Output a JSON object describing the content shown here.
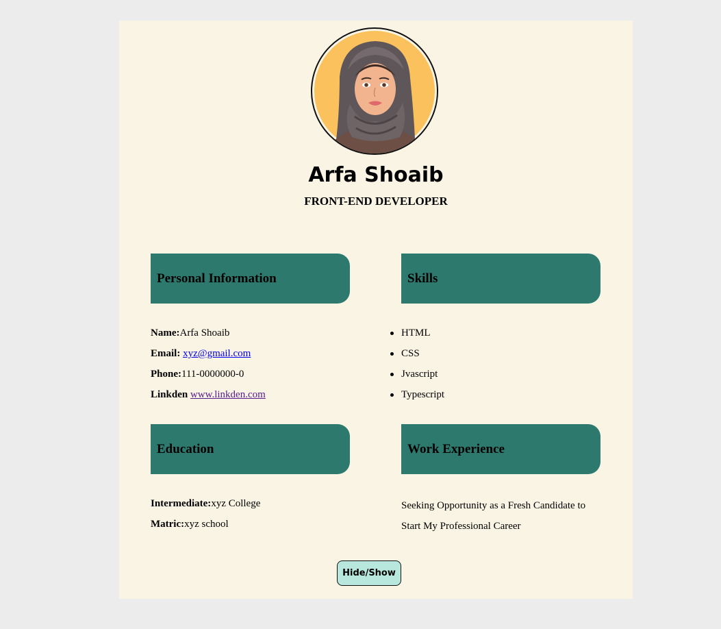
{
  "profile": {
    "name": "Arfa Shoaib",
    "role": "FRONT-END DEVELOPER",
    "avatar_icon": "hijab-woman-avatar"
  },
  "colors": {
    "page_background": "#ececec",
    "card_background": "#faf4e5",
    "section_header": "#2d796e",
    "button_background": "#b8e8dd"
  },
  "sections": {
    "personal": {
      "title": "Personal Information",
      "name_label": "Name:",
      "name_value": "Arfa Shoaib",
      "email_label": "Email:",
      "email_value": "xyz@gmail.com",
      "phone_label": "Phone:",
      "phone_value": "111-0000000-0",
      "linkedin_label": "Linkden",
      "linkedin_value": "www.linkden.com"
    },
    "skills": {
      "title": "Skills",
      "items": [
        "HTML",
        "CSS",
        "Jvascript",
        "Typescript"
      ]
    },
    "education": {
      "title": "Education",
      "intermediate_label": "Intermediate:",
      "intermediate_value": "xyz College",
      "matric_label": "Matric:",
      "matric_value": "xyz school"
    },
    "work": {
      "title": "Work Experience",
      "description": "Seeking Opportunity as a Fresh Candidate to Start My Professional Career"
    }
  },
  "toggle_button": {
    "label": "Hide/Show"
  }
}
